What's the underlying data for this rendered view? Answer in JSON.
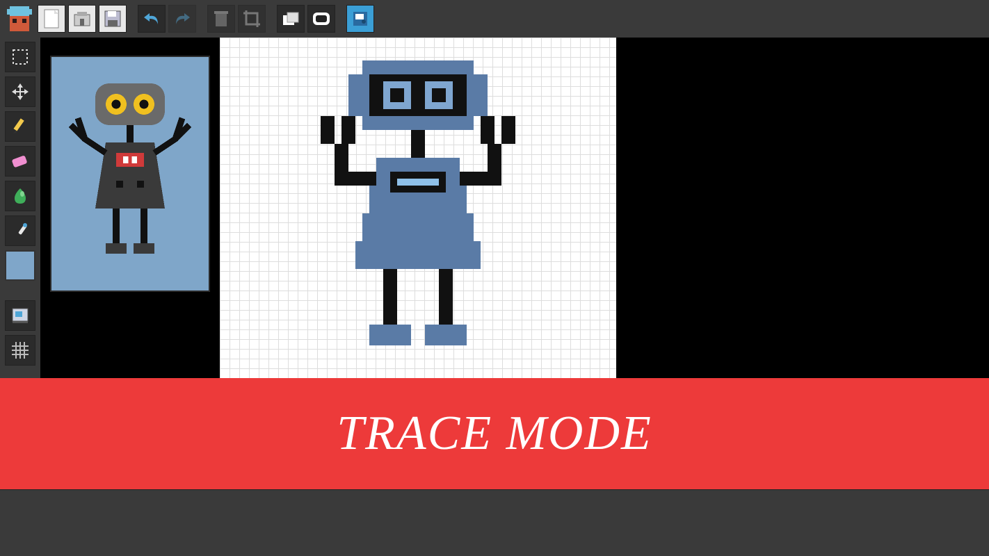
{
  "banner_text": "TRACE MODE",
  "toolbar": {
    "new_label": "New",
    "open_label": "Open",
    "save_label": "Save",
    "undo_label": "Undo",
    "redo_label": "Redo",
    "delete_label": "Delete",
    "crop_label": "Crop",
    "layers_label": "Layers",
    "preview_label": "Preview",
    "trace_label": "Trace"
  },
  "tools": {
    "select": "Select",
    "move": "Move",
    "pencil": "Pencil",
    "eraser": "Eraser",
    "fill": "Fill",
    "eyedropper": "Eyedropper",
    "swatch_color": "#7fa6c9",
    "export": "Export",
    "grid": "Grid"
  },
  "canvas": {
    "subject": "robot pixel art",
    "preview_bg": "#7fa6c9",
    "canvas_bg": "#ffffff"
  },
  "colors": {
    "accent_blue": "#5a7ba6",
    "dark": "#111111",
    "banner": "#ed3a3a"
  }
}
